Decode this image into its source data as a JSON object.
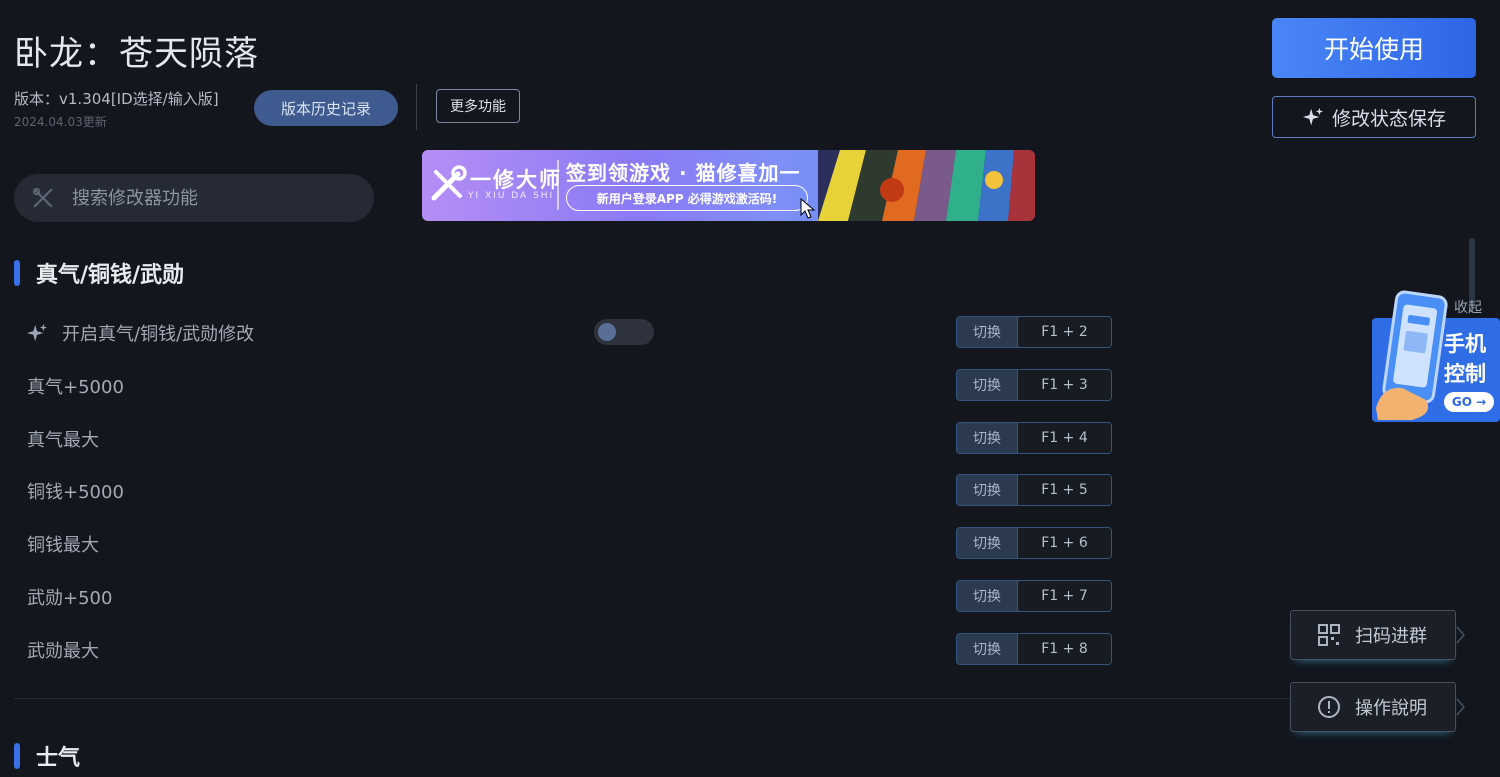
{
  "header": {
    "title": "卧龙：苍天陨落",
    "version": "版本：v1.304[ID选择/输入版]",
    "updated": "2024.04.03更新",
    "history_label": "版本历史记录",
    "more_label": "更多功能"
  },
  "search": {
    "placeholder": "搜索修改器功能"
  },
  "banner": {
    "brand": "一修大师",
    "brand_en": "YI XIU DA SHI",
    "main_text": "签到领游戏 · 猫修喜加一",
    "sub_text": "新用户登录APP  必得游戏激活码!"
  },
  "actions": {
    "start_label": "开始使用",
    "save_label": "修改状态保存"
  },
  "sections": [
    {
      "title": "真气/铜钱/武勋",
      "rows": [
        {
          "label": "开启真气/铜钱/武勋修改",
          "switch": "切换",
          "keys": "F1 + 2",
          "toggle_on": false
        },
        {
          "label": "真气+5000",
          "switch": "切换",
          "keys": "F1 + 3"
        },
        {
          "label": "真气最大",
          "switch": "切换",
          "keys": "F1 + 4"
        },
        {
          "label": "铜钱+5000",
          "switch": "切换",
          "keys": "F1 + 5"
        },
        {
          "label": "铜钱最大",
          "switch": "切换",
          "keys": "F1 + 6"
        },
        {
          "label": "武勋+500",
          "switch": "切换",
          "keys": "F1 + 7"
        },
        {
          "label": "武勋最大",
          "switch": "切换",
          "keys": "F1 + 8"
        }
      ]
    },
    {
      "title": "士气"
    }
  ],
  "side": {
    "collapse_label": "收起",
    "phone_line1": "手机",
    "phone_line2": "控制",
    "go_label": "GO →",
    "qr_label": "扫码进群",
    "help_label": "操作說明"
  },
  "colors": {
    "background": "#13161d",
    "accent": "#3a6fe8",
    "start_button": "#2d66e6"
  }
}
